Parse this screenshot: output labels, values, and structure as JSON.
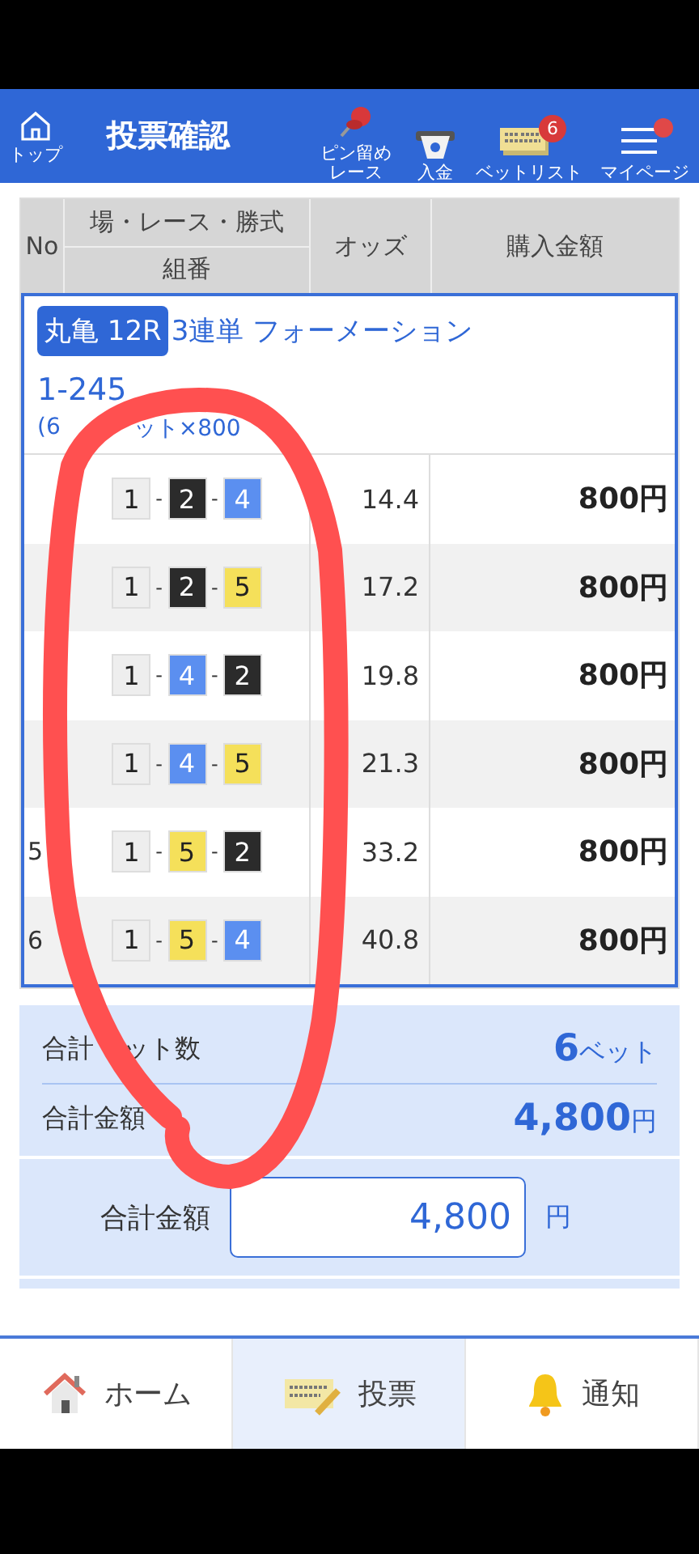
{
  "header": {
    "home_label": "トップ",
    "title": "投票確認",
    "actions": [
      {
        "kind": "pin",
        "label": "ピン留めレース"
      },
      {
        "kind": "deposit",
        "label": "入金"
      },
      {
        "kind": "betlist",
        "label": "ベットリスト",
        "badge": "6"
      },
      {
        "kind": "menu",
        "label": "マイページ"
      }
    ]
  },
  "table": {
    "columns": {
      "no": "No",
      "race": "場・レース・勝式",
      "combo": "組番",
      "odds": "オッズ",
      "amount": "購入金額"
    },
    "group": {
      "venue": "丸亀 12R",
      "bet_type": "3連単 フォーメーション",
      "selection": "1-245",
      "detail_parts": [
        "(6",
        "ット×800"
      ]
    },
    "rows": [
      {
        "boats": [
          {
            "num": "1",
            "color": "#eeeeee"
          },
          {
            "sep": "-",
            "num": "2",
            "color": "#2b2b2b"
          },
          {
            "sep": "-",
            "num": "4",
            "color": "#5b8ff0"
          }
        ],
        "odds": "14.4",
        "amount": "800円"
      },
      {
        "boats": [
          {
            "num": "1",
            "color": "#eeeeee"
          },
          {
            "sep": "-",
            "num": "2",
            "color": "#2b2b2b"
          },
          {
            "sep": "-",
            "num": "5",
            "color": "#f5e05a"
          }
        ],
        "odds": "17.2",
        "amount": "800円"
      },
      {
        "boats": [
          {
            "num": "1",
            "color": "#eeeeee"
          },
          {
            "sep": "-",
            "num": "4",
            "color": "#5b8ff0"
          },
          {
            "sep": "-",
            "num": "2",
            "color": "#2b2b2b"
          }
        ],
        "odds": "19.8",
        "amount": "800円"
      },
      {
        "boats": [
          {
            "num": "1",
            "color": "#eeeeee"
          },
          {
            "sep": "-",
            "num": "4",
            "color": "#5b8ff0"
          },
          {
            "sep": "-",
            "num": "5",
            "color": "#f5e05a"
          }
        ],
        "odds": "21.3",
        "amount": "800円"
      },
      {
        "no": "5",
        "boats": [
          {
            "num": "1",
            "color": "#eeeeee"
          },
          {
            "sep": "-",
            "num": "5",
            "color": "#f5e05a"
          },
          {
            "sep": "-",
            "num": "2",
            "color": "#2b2b2b"
          }
        ],
        "odds": "33.2",
        "amount": "800円"
      },
      {
        "no": "6",
        "boats": [
          {
            "num": "1",
            "color": "#eeeeee"
          },
          {
            "sep": "-",
            "num": "5",
            "color": "#f5e05a"
          },
          {
            "sep": "-",
            "num": "4",
            "color": "#5b8ff0"
          }
        ],
        "odds": "40.8",
        "amount": "800円"
      }
    ]
  },
  "summary": {
    "bets_label_parts": [
      "合計",
      "ット数"
    ],
    "bets_value": "6",
    "bets_unit": "ベット",
    "total_label": "合計金額",
    "total_value": "4,800",
    "total_unit": "円"
  },
  "input": {
    "label": "合計金額",
    "value": "4,800",
    "unit": "円"
  },
  "bottom_nav": [
    {
      "kind": "home",
      "label": "ホーム",
      "selected": false
    },
    {
      "kind": "vote",
      "label": "投票",
      "selected": true
    },
    {
      "kind": "bell",
      "label": "通知",
      "selected": false
    }
  ]
}
